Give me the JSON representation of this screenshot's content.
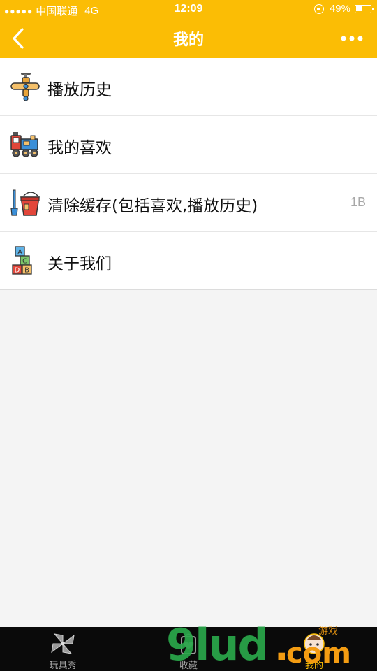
{
  "status_bar": {
    "signal_dots": "●●●●●",
    "carrier": "中国联通",
    "network": "4G",
    "time": "12:09",
    "battery": "49%",
    "battery_level": 0.49
  },
  "navbar": {
    "title": "我的",
    "back_icon": "chevron-left-icon",
    "more_icon": "ellipsis-icon"
  },
  "menu": {
    "items": [
      {
        "label": "播放历史",
        "icon": "toy-airplane-icon",
        "value": ""
      },
      {
        "label": "我的喜欢",
        "icon": "toy-train-icon",
        "value": ""
      },
      {
        "label": "清除缓存(包括喜欢,播放历史)",
        "icon": "bucket-shovel-icon",
        "value": "1B"
      },
      {
        "label": "关于我们",
        "icon": "abc-blocks-icon",
        "value": ""
      }
    ]
  },
  "tabbar": {
    "tabs": [
      {
        "label": "玩具秀",
        "icon": "pinwheel-icon",
        "active": false
      },
      {
        "label": "收藏",
        "icon": "heart-bag-icon",
        "active": false
      },
      {
        "label": "我的",
        "icon": "baby-face-icon",
        "active": true
      }
    ]
  },
  "watermark": {
    "text_main": "9lud",
    "text_dot": ".",
    "text_com": "com",
    "text_small": "游戏"
  },
  "colors": {
    "brand": "#fbbd05",
    "tabbar_bg": "#0a0a0a",
    "page_bg": "#f4f4f4",
    "watermark_green": "#2aa84a",
    "watermark_orange": "#f39c12"
  }
}
